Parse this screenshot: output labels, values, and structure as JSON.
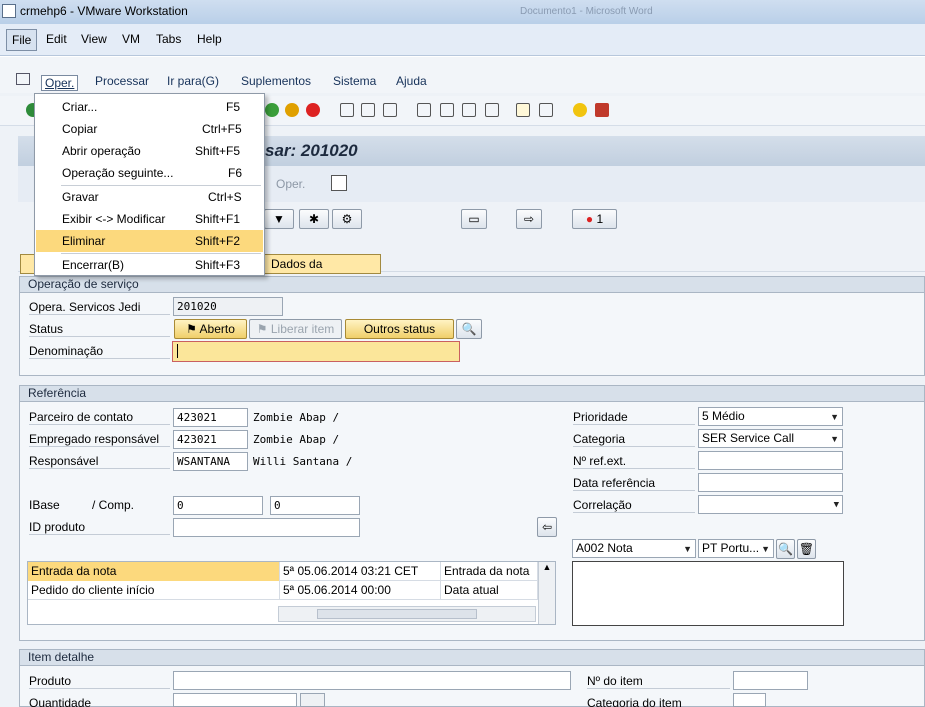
{
  "window": {
    "title": "crmehp6 - VMware Workstation",
    "background_title": "Documento1 - Microsoft Word"
  },
  "vm_menu": [
    "File",
    "Edit",
    "View",
    "VM",
    "Tabs",
    "Help"
  ],
  "sap_menu": [
    "Oper.",
    "Processar",
    "Ir para(G)",
    "Suplementos",
    "Sistema",
    "Ajuda"
  ],
  "page": {
    "title": "Processar: 201020",
    "title_visible": "sar: 201020"
  },
  "app_toolbar": {
    "oper_label": "Oper."
  },
  "dropdown": {
    "items": [
      {
        "label": "Criar...",
        "shortcut": "F5"
      },
      {
        "label": "Copiar",
        "shortcut": "Ctrl+F5"
      },
      {
        "label": "Abrir operação",
        "shortcut": "Shift+F5"
      },
      {
        "label": "Operação seguinte...",
        "shortcut": "F6"
      },
      {
        "label": "Gravar",
        "shortcut": "Ctrl+S"
      },
      {
        "label": "Exibir <-> Modificar",
        "shortcut": "Shift+F1"
      },
      {
        "label": "Eliminar",
        "shortcut": "Shift+F2"
      },
      {
        "label": "Encerrar(B)",
        "shortcut": "Shift+F3"
      }
    ],
    "highlighted": "Eliminar"
  },
  "alert_count": "1",
  "tabs": {
    "dados": "Dados da operação"
  },
  "operacao": {
    "heading": "Operação de serviço",
    "opera_label": "Opera. Servicos Jedi",
    "opera_value": "201020",
    "status_label": "Status",
    "status_aberto": "Aberto",
    "status_liberar": "Liberar item",
    "status_outros": "Outros status",
    "denominacao_label": "Denominação",
    "denominacao_value": ""
  },
  "referencia": {
    "heading": "Referência",
    "parceiro_label": "Parceiro de contato",
    "parceiro_value": "423021",
    "parceiro_name": "Zombie Abap /",
    "empregado_label": "Empregado responsável",
    "empregado_value": "423021",
    "empregado_name": "Zombie Abap /",
    "responsavel_label": "Responsável",
    "responsavel_value": "WSANTANA",
    "responsavel_name": "Willi Santana /",
    "ibase_label": "IBase",
    "comp_label": "/ Comp.",
    "ibase_value": "0",
    "comp_value": "0",
    "idproduto_label": "ID produto",
    "prioridade_label": "Prioridade",
    "prioridade_value": "5 Médio",
    "categoria_label": "Categoria",
    "categoria_value": "SER Service Call",
    "refext_label": "Nº ref.ext.",
    "datareferencia_label": "Data referência",
    "correlacao_label": "Correlação",
    "nota_type": "A002 Nota",
    "nota_lang": "PT Portu..."
  },
  "dates_table": [
    {
      "name": "Entrada da nota",
      "value": "5ª 05.06.2014 03:21 CET",
      "type": "Entrada da nota"
    },
    {
      "name": "Pedido do cliente início",
      "value": "5ª 05.06.2014 00:00",
      "type": "Data atual"
    }
  ],
  "item": {
    "heading": "Item detalhe",
    "produto_label": "Produto",
    "quantidade_label": "Quantidade",
    "nitem_label": "Nº do item",
    "categoria_item_label": "Categoria do item"
  }
}
